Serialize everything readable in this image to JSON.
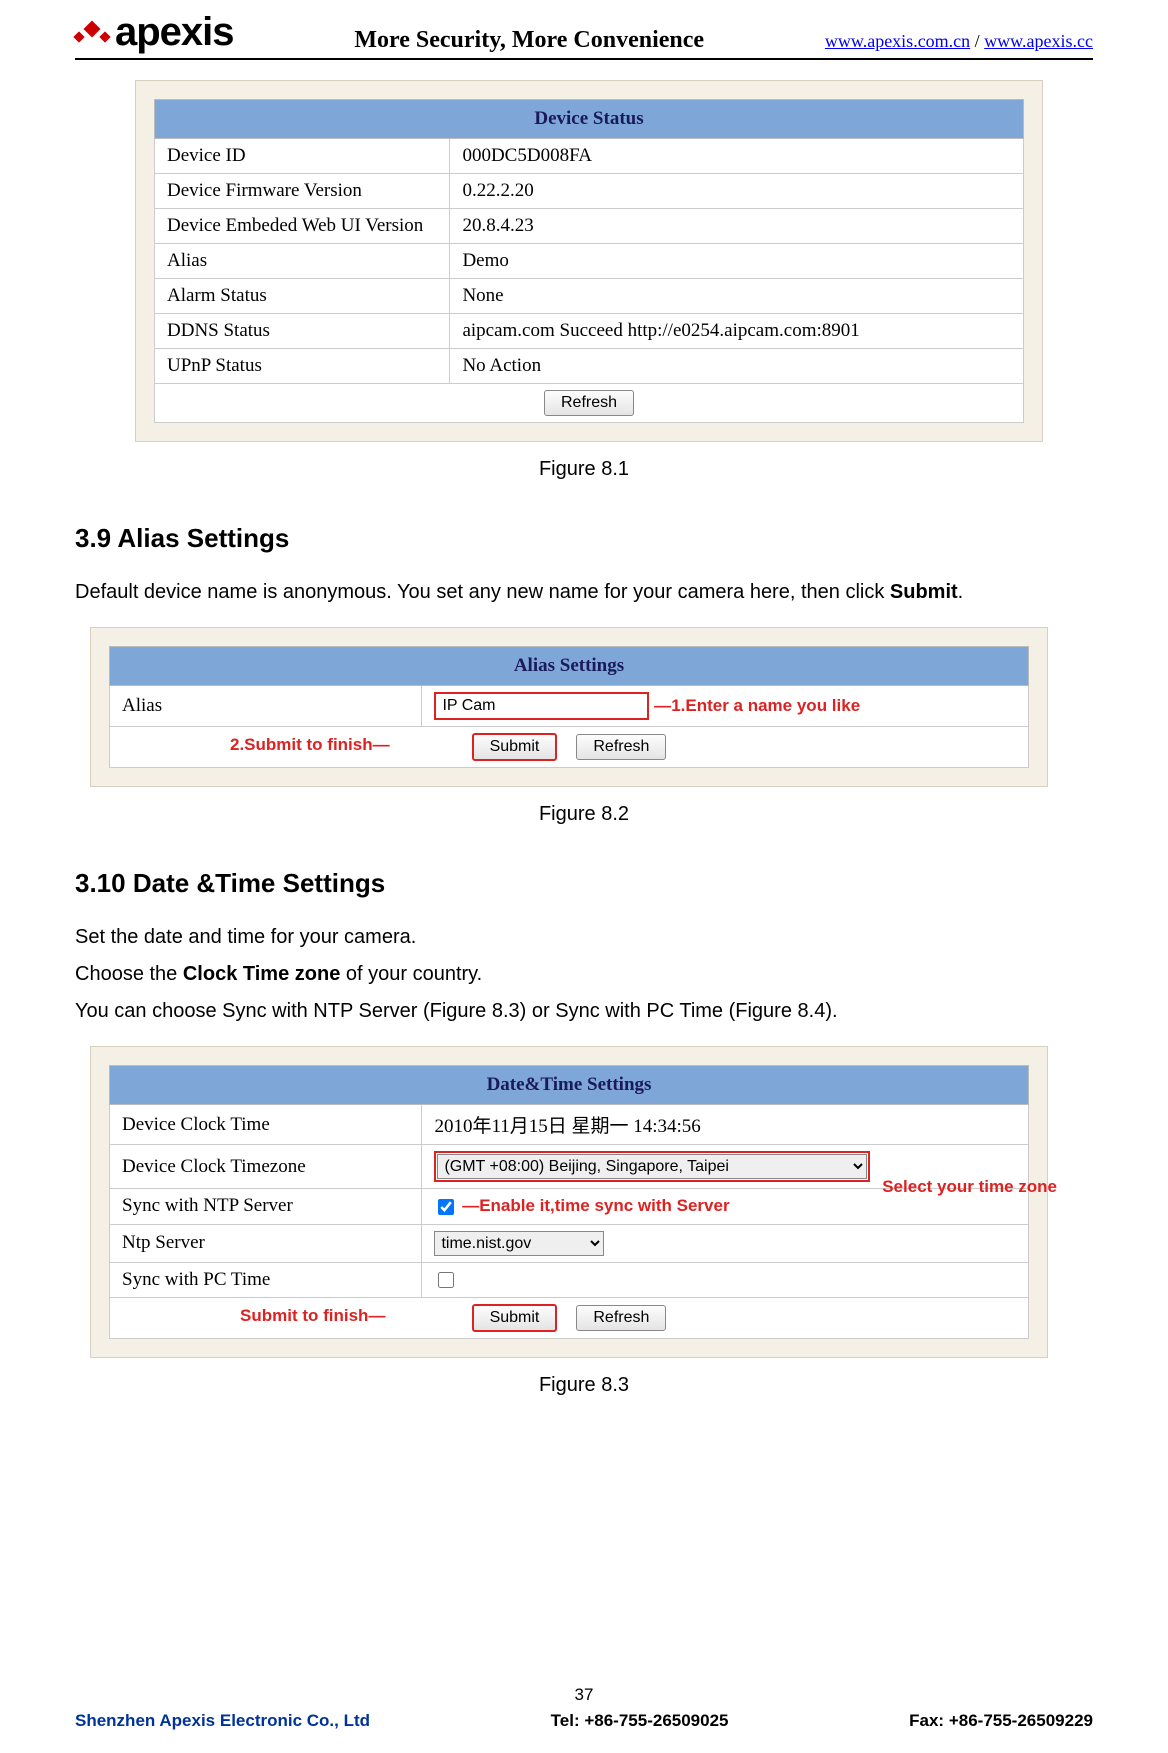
{
  "header": {
    "logo_text": "apexis",
    "slogan": "More Security, More Convenience",
    "link1": "www.apexis.com.cn",
    "sep": " / ",
    "link2": "www.apexis.cc"
  },
  "fig81": {
    "title": "Device Status",
    "rows": [
      {
        "l": "Device ID",
        "v": "000DC5D008FA"
      },
      {
        "l": "Device Firmware Version",
        "v": "0.22.2.20"
      },
      {
        "l": "Device Embeded Web UI Version",
        "v": "20.8.4.23"
      },
      {
        "l": "Alias",
        "v": "Demo"
      },
      {
        "l": "Alarm Status",
        "v": "None"
      },
      {
        "l": "DDNS Status",
        "v": "aipcam.com  Succeed  http://e0254.aipcam.com:8901"
      },
      {
        "l": "UPnP Status",
        "v": "No Action"
      }
    ],
    "refresh": "Refresh",
    "caption": "Figure 8.1"
  },
  "sec39": {
    "heading": "3.9 Alias Settings",
    "para_a": "Default device name is anonymous. You set any new name for your camera here, then click ",
    "para_b_strong": "Submit",
    "para_c": "."
  },
  "fig82": {
    "title": "Alias Settings",
    "row_label": "Alias",
    "input_value": "IP Cam",
    "ann1": "1.Enter a name you like",
    "ann2": "2.Submit to finish",
    "submit": "Submit",
    "refresh": "Refresh",
    "caption": "Figure 8.2"
  },
  "sec310": {
    "heading": "3.10 Date &Time Settings",
    "p1": "Set the date and time for your camera.",
    "p2a": "Choose the ",
    "p2b_strong": "Clock Time zone",
    "p2c": " of your country.",
    "p3": "You can choose Sync with NTP Server (Figure 8.3) or Sync with PC Time (Figure 8.4)."
  },
  "fig83": {
    "title": "Date&Time Settings",
    "rows": {
      "r1l": "Device Clock Time",
      "r1v": "2010年11月15日  星期一  14:34:56",
      "r2l": "Device Clock Timezone",
      "r2v": "(GMT +08:00) Beijing, Singapore, Taipei",
      "r3l": "Sync with NTP Server",
      "r3ann": "Enable it,time sync with Server",
      "r2ann": "Select your time zone",
      "r4l": "Ntp Server",
      "r4v": "time.nist.gov",
      "r5l": "Sync with PC Time"
    },
    "ann_submit": "Submit to finish",
    "submit": "Submit",
    "refresh": "Refresh",
    "caption": "Figure 8.3"
  },
  "footer": {
    "page": "37",
    "company": "Shenzhen Apexis Electronic Co., Ltd",
    "tel": "Tel: +86-755-26509025",
    "fax": "Fax: +86-755-26509229"
  }
}
